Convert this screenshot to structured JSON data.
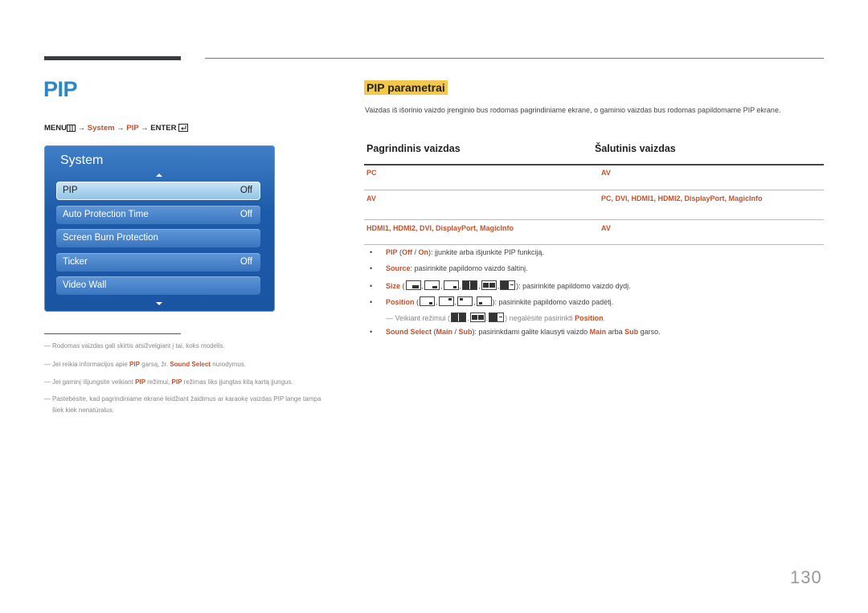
{
  "page": {
    "title": "PIP",
    "page_number": "130"
  },
  "menu_path": {
    "menu": "MENU",
    "arrow": "→",
    "system": "System",
    "pip": "PIP",
    "enter": "ENTER"
  },
  "osd": {
    "title": "System",
    "items": [
      {
        "label": "PIP",
        "value": "Off",
        "selected": true
      },
      {
        "label": "Auto Protection Time",
        "value": "Off"
      },
      {
        "label": "Screen Burn Protection",
        "value": ""
      },
      {
        "label": "Ticker",
        "value": "Off"
      },
      {
        "label": "Video Wall",
        "value": ""
      }
    ]
  },
  "footnotes": {
    "dash": "―",
    "f1": "Rodomas vaizdas gali skirtis atsižvelgiant į tai, koks modelis.",
    "f2_a": "Jei reikia informacijos apie ",
    "f2_b": "PIP",
    "f2_c": " garsą, žr. ",
    "f2_d": "Sound Select",
    "f2_e": " nurodymus.",
    "f3_a": "Jei gaminį išjungsite veikiant ",
    "f3_b": "PIP",
    "f3_c": " režimui, ",
    "f3_d": "PIP",
    "f3_e": " režimas liks įjungtas kitą kartą įjungus.",
    "f4_a": "Pastebėsite, kad pagrindiniame ekrane leidžiant žaidimus ar karaokę vaizdas PIP lange tampa",
    "f4_b": "šiek kiek nenatūralus."
  },
  "section": {
    "title": "PIP parametrai",
    "intro": "Vaizdas iš išorinio vaizdo įrenginio bus rodomas pagrindiniame ekrane, o gaminio vaizdas bus rodomas papildomame PIP ekrane."
  },
  "table": {
    "headers": [
      "Pagrindinis vaizdas",
      "Šalutinis vaizdas"
    ],
    "rows": [
      [
        "PC",
        "AV"
      ],
      [
        "AV",
        "PC, DVI, HDMI1, HDMI2, DisplayPort, MagicInfo"
      ],
      [
        "HDMI1, HDMI2, DVI, DisplayPort, MagicInfo",
        "AV"
      ]
    ]
  },
  "bullets": {
    "dot": "•",
    "pip_label": "PIP",
    "pip_open": " (",
    "pip_off": "Off",
    "pip_slash": " / ",
    "pip_on": "On",
    "pip_text": "): įjunkite arba išjunkite PIP funkciją.",
    "source_label": "Source",
    "source_text": ": pasirinkite papildomo vaizdo šaltinį.",
    "size_label": "Size",
    "size_text": "): pasirinkite papildomo vaizdo dydį.",
    "position_label": "Position",
    "position_text": "): pasirinkite papildomo vaizdo padėtį.",
    "note_a": "Veikiant režimui (",
    "note_b": ") negalėsite pasirinkti ",
    "note_c": "Position",
    "note_d": ".",
    "sound_label": "Sound Select",
    "sound_main": "Main",
    "sound_sub": "Sub",
    "sound_text_a": "): pasirinkdami galite klausyti vaizdo ",
    "sound_text_b": " arba ",
    "sound_text_c": " garso.",
    "paren_open": " (",
    "comma": ","
  },
  "colors": {
    "accent": "#c8502a",
    "title_blue": "#2a86c8",
    "highlight": "#f4c94b",
    "osd_blue": "#1d5aa8"
  }
}
